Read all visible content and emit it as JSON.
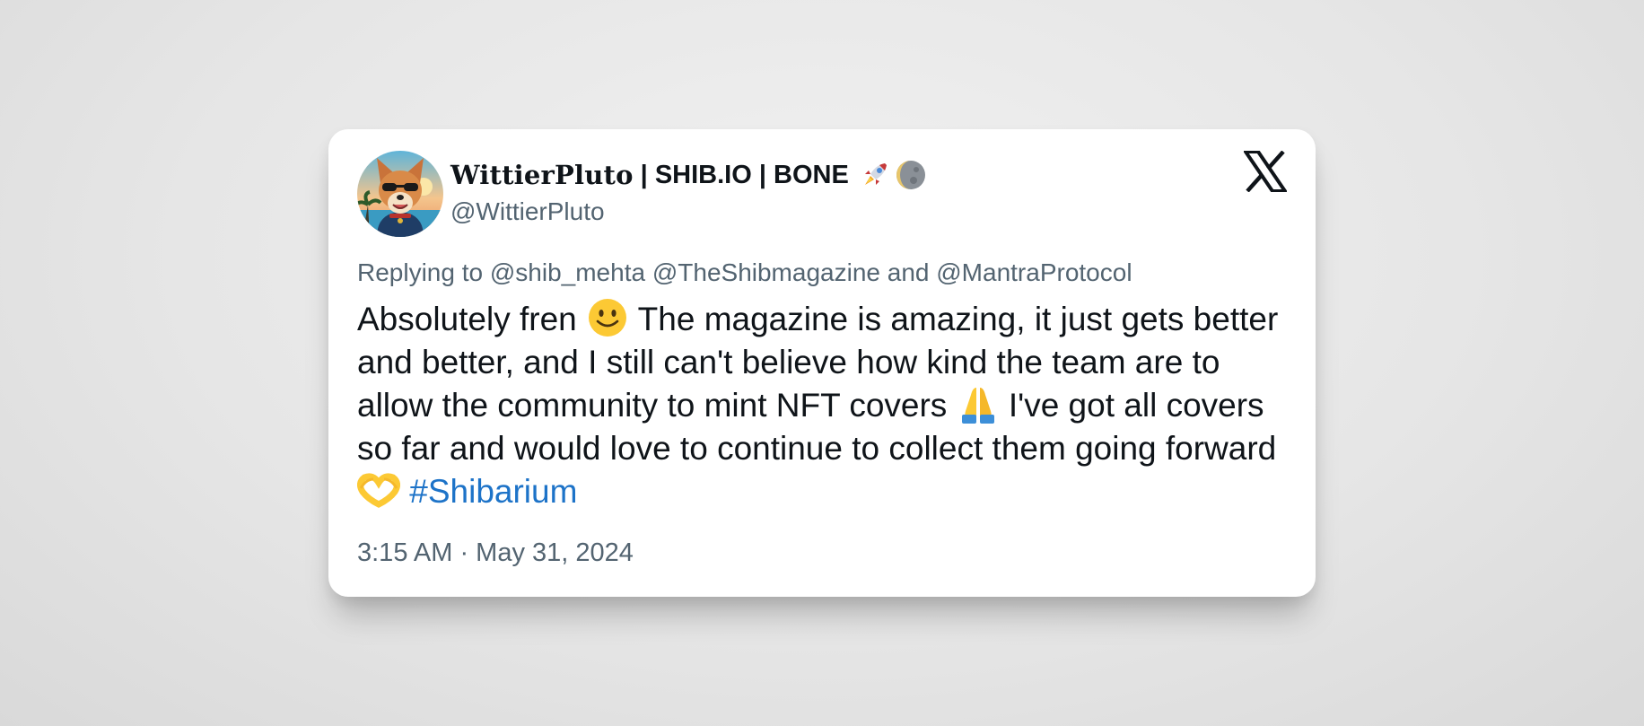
{
  "tweet": {
    "display_name_styled": "WittierPluto",
    "display_name_rest": "| SHIB.IO | BONE",
    "name_emojis": [
      "rocket-icon",
      "moon-icon"
    ],
    "handle": "@WittierPluto",
    "replying_prefix": "Replying to",
    "reply_mention_1": "@shib_mehta",
    "reply_mention_2": "@TheShibmagazine",
    "reply_and": "and",
    "reply_mention_3": "@MantraProtocol",
    "body_part_1": "Absolutely fren",
    "body_part_2": "The magazine is amazing, it just gets better and better, and I still can't believe how kind the team are to allow the community to mint NFT covers",
    "body_part_3": "I've got all covers so far and would love to continue to collect them going forward",
    "body_emojis": [
      "smiling-face-emoji",
      "folded-hands-emoji",
      "heart-hands-emoji"
    ],
    "hashtag": "#Shibarium",
    "timestamp": "3:15 AM · May 31, 2024"
  },
  "colors": {
    "text_primary": "#0f1419",
    "text_secondary": "#536471",
    "hashtag": "#1d73c8",
    "card_background": "#ffffff"
  }
}
